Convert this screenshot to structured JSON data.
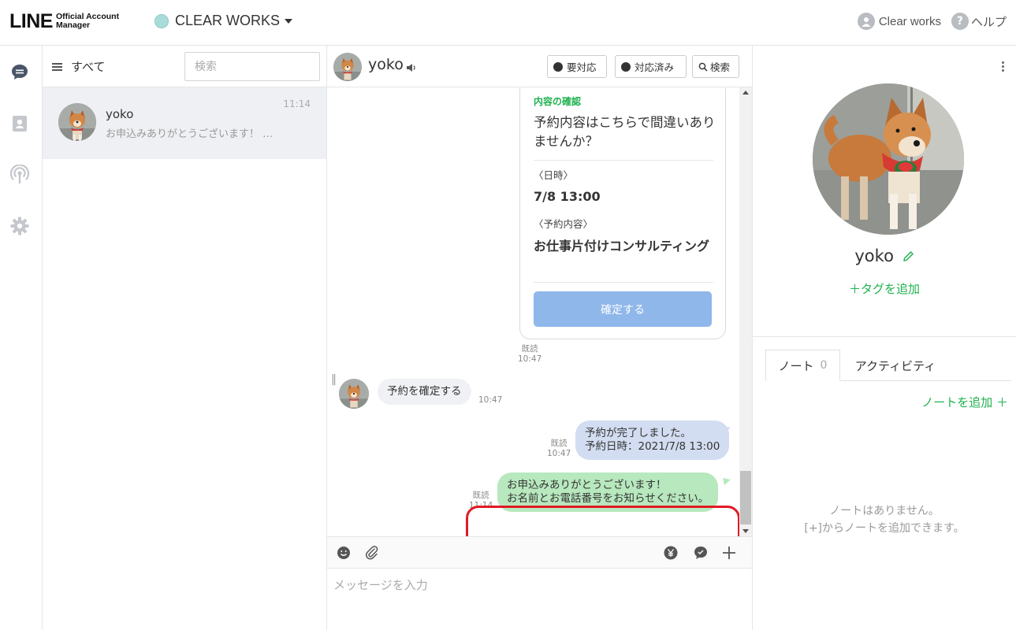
{
  "header": {
    "logo_main": "LINE",
    "logo_sub1": "Official Account",
    "logo_sub2": "Manager",
    "account_name": "CLEAR WORKS",
    "user_name": "Clear works",
    "help_label": "ヘルプ"
  },
  "rail": {
    "icons": [
      "chat-icon",
      "contacts-icon",
      "broadcast-icon",
      "settings-icon"
    ]
  },
  "chat_list": {
    "filter_label": "すべて",
    "search_placeholder": "検索",
    "items": [
      {
        "name": "yoko",
        "preview": "お申込みありがとうございます！ お...",
        "time": "11:14"
      }
    ]
  },
  "chat": {
    "contact_name": "yoko",
    "buttons": {
      "needs_reply": "要対応",
      "resolved": "対応済み",
      "search": "検索"
    },
    "card": {
      "title": "内容の確認",
      "question": "予約内容はこちらで間違いありませんか？",
      "date_label": "〈日時〉",
      "date_value": "7/8 13:00",
      "content_label": "〈予約内容〉",
      "content_value": "お仕事片付けコンサルティング",
      "confirm_button": "確定する"
    },
    "messages": [
      {
        "read": "既読",
        "time": "10:47"
      },
      {
        "from": "user",
        "text": "予約を確定する",
        "time": "10:47"
      },
      {
        "from": "account",
        "read": "既読",
        "time": "10:47",
        "line1": "予約が完了しました。",
        "line2": "予約日時：2021/7/8 13:00"
      },
      {
        "from": "account",
        "read": "既読",
        "time": "11:14",
        "line1": "お申込みありがとうございます！",
        "line2": "お名前とお電話番号をお知らせください。"
      }
    ],
    "input_placeholder": "メッセージを入力"
  },
  "profile": {
    "name": "yoko",
    "add_tag": "＋タグを追加",
    "tabs": {
      "notes": "ノート",
      "notes_count": "0",
      "activity": "アクティビティ"
    },
    "add_note": "ノートを追加 ＋",
    "empty_line1": "ノートはありません。",
    "empty_line2": "[+]からノートを追加できます。"
  },
  "colors": {
    "line_green": "#1fb14f",
    "bubble_blue": "#d2ddf1",
    "bubble_green": "#b8e8be",
    "confirm_button": "#8fb7ea",
    "highlight_red": "#e01b24"
  }
}
